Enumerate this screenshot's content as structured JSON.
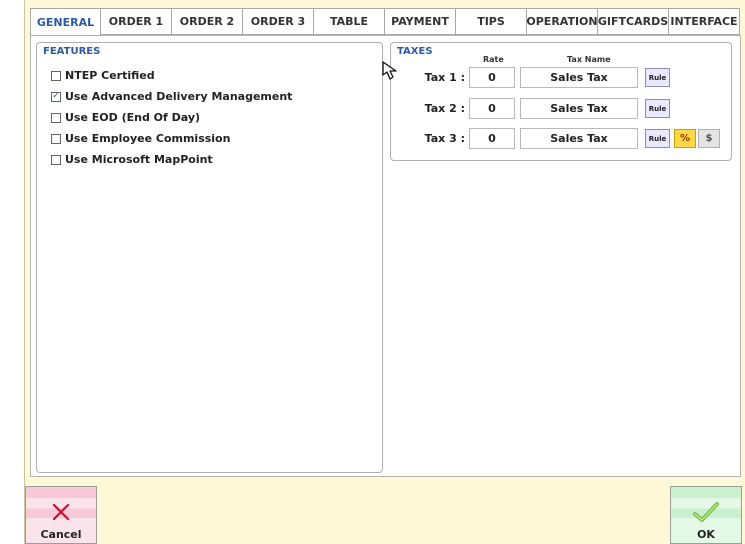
{
  "tabs": [
    "GENERAL",
    "ORDER 1",
    "ORDER 2",
    "ORDER 3",
    "TABLE",
    "PAYMENT",
    "TIPS",
    "OPERATION",
    "GIFTCARDS",
    "INTERFACE"
  ],
  "active_tab": "GENERAL",
  "features": {
    "title": "FEATURES",
    "items": [
      {
        "label": "NTEP Certified",
        "checked": false
      },
      {
        "label": "Use Advanced Delivery Management",
        "checked": true
      },
      {
        "label": "Use EOD (End Of Day)",
        "checked": false
      },
      {
        "label": "Use Employee Commission",
        "checked": false
      },
      {
        "label": "Use Microsoft MapPoint",
        "checked": false
      }
    ]
  },
  "taxes": {
    "title": "TAXES",
    "rate_header": "Rate",
    "name_header": "Tax Name",
    "rows": [
      {
        "label": "Tax 1 :",
        "rate": "0",
        "name": "Sales Tax",
        "rule": "Rule"
      },
      {
        "label": "Tax 2 :",
        "rate": "0",
        "name": "Sales Tax",
        "rule": "Rule"
      },
      {
        "label": "Tax 3 :",
        "rate": "0",
        "name": "Sales Tax",
        "rule": "Rule"
      }
    ],
    "percent_label": "%",
    "dollar_label": "$"
  },
  "buttons": {
    "cancel": "Cancel",
    "ok": "OK"
  },
  "colors": {
    "accent": "#2c5aa0",
    "window_bg": "#fdf8d6",
    "cancel_bg": "#f7c9d8",
    "ok_bg": "#c9f0cf",
    "cancel_x": "#c8102e",
    "ok_check": "#7cc242"
  }
}
